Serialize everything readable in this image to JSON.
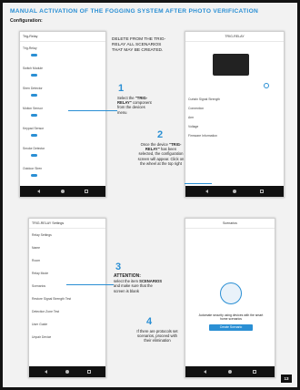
{
  "header": {
    "title": "MANUAL ACTIVATION OF THE FOGGING SYSTEM AFTER PHOTO VERIFICATION",
    "subtitle": "Configuration:"
  },
  "steps": [
    {
      "id": "s0",
      "text": "DELETE FROM THE TRIG-RELAY ALL SCENARIOS THAT MAY BE CREATED."
    },
    {
      "id": "s1",
      "num": "1",
      "pre": "Select the",
      "bold": "\"TRIG-RELAY\"",
      "post": "component from the devices menu"
    },
    {
      "id": "s2",
      "num": "2",
      "pre": "Once the device",
      "bold": "\"TRIG-RELAY\"",
      "post": "has been selected, the configuration screen will appear. Click on the wheel at the top right"
    },
    {
      "id": "s3",
      "num": "3",
      "bold": "ATTENTION:",
      "pre": "select the item",
      "bold2": "SCENARIOS",
      "post": "and make sure that the screen is blank"
    },
    {
      "id": "s4",
      "num": "4",
      "text": "If there are protocols set scenarios, proceed with their elimination"
    }
  ],
  "screens": {
    "a": {
      "title": "Trig-Relay",
      "rows": [
        "Trig-Relay",
        "Switch Module",
        "Siren Detector",
        "Motion Sensor",
        "Keypad Sensor",
        "Smoke Detector",
        "Outdoor Siren"
      ]
    },
    "b": {
      "title": "TRIG-RELAY",
      "rows": [
        "Curtain Signal Strength",
        "Connection",
        "Arm",
        "Voltage",
        "Firmware Information"
      ]
    },
    "c": {
      "title": "TRIG-RELAY Settings",
      "rows": [
        "Relay Settings",
        "Name",
        "Room",
        "Relay Mode",
        "Scenarios",
        "Restore Signal Strength Test",
        "Detection Zone Test",
        "User Guide",
        "Unpair Device"
      ]
    },
    "d": {
      "title": "Scenarios",
      "text": "Automate security using devices with the smart home scenarios",
      "button": "Create Scenario"
    }
  },
  "page_number": "13"
}
